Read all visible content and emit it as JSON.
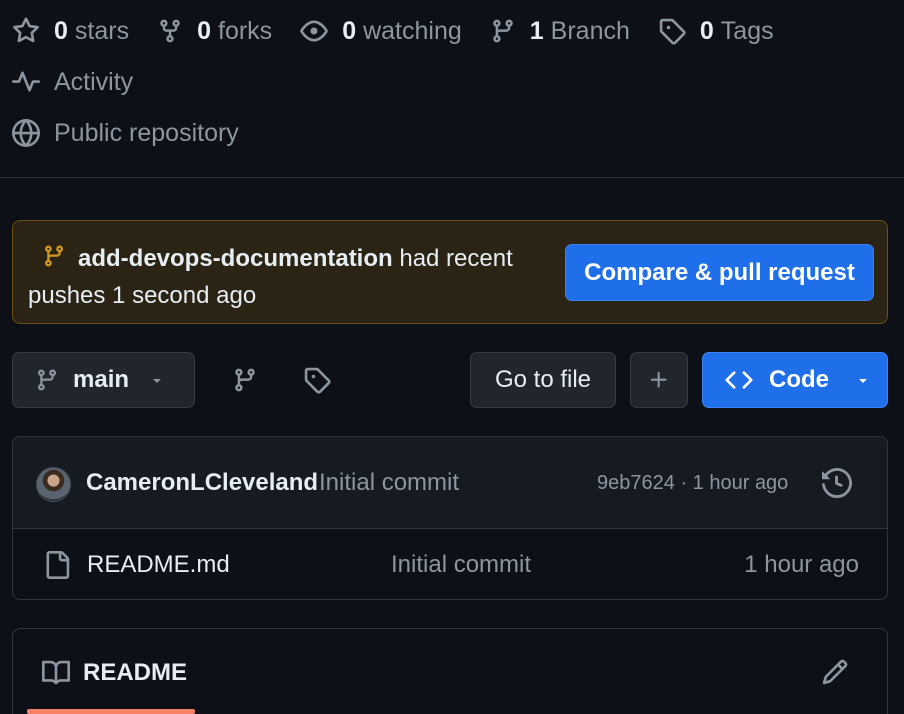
{
  "repo_stats": {
    "stars": {
      "count": "0",
      "label": "stars",
      "icon": "star-icon"
    },
    "forks": {
      "count": "0",
      "label": "forks",
      "icon": "fork-icon"
    },
    "watching": {
      "count": "0",
      "label": "watching",
      "icon": "eye-icon"
    },
    "branches": {
      "count": "1",
      "label": "Branch",
      "icon": "branch-icon"
    },
    "tags": {
      "count": "0",
      "label": "Tags",
      "icon": "tag-icon"
    }
  },
  "activity_label": "Activity",
  "visibility_label": "Public repository",
  "push_banner": {
    "branch_name": "add-devops-documentation",
    "message": "had recent pushes 1 second ago",
    "button_label": "Compare & pull request",
    "icon_color": "#d29922"
  },
  "toolbar": {
    "branch_selector": "main",
    "go_to_file": "Go to file",
    "add_label": "+",
    "code_label": "Code"
  },
  "latest_commit": {
    "author": "CameronLCleveland",
    "message": "Initial commit",
    "sha": "9eb7624",
    "separator": "·",
    "time": "1 hour ago"
  },
  "files": [
    {
      "name": "README.md",
      "commit_message": "Initial commit",
      "time": "1 hour ago",
      "icon": "file-icon"
    }
  ],
  "readme": {
    "title": "README",
    "accent_color": "#f78166"
  },
  "colors": {
    "background": "#0d1117",
    "primary_button": "#1f6feb",
    "muted_text": "#8d96a0",
    "banner_bg": "#2b2415"
  }
}
